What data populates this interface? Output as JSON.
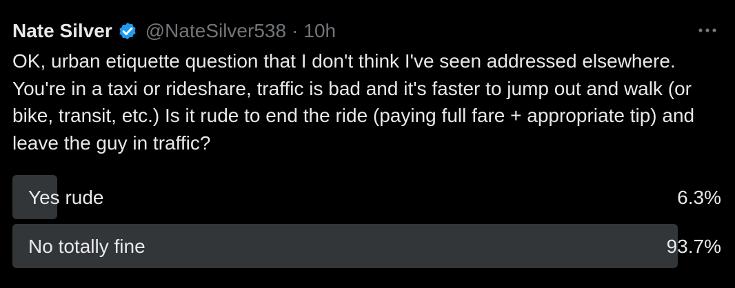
{
  "tweet": {
    "author_name": "Nate Silver",
    "handle": "@NateSilver538",
    "separator": "·",
    "time": "10h",
    "text": "OK, urban etiquette question that I don't think I've seen addressed elsewhere. You're in a taxi or rideshare, traffic is bad and it's faster to jump out and walk (or bike, transit, etc.) Is it rude to end the ride (paying full fare + appropriate tip) and leave the guy in traffic?",
    "verified_icon": "verified-badge-icon",
    "more_icon": "more-options-icon"
  },
  "poll": {
    "options": [
      {
        "label": "Yes rude",
        "percent_text": "6.3%",
        "fraction": 0.063
      },
      {
        "label": "No totally fine",
        "percent_text": "93.7%",
        "fraction": 0.937
      }
    ]
  },
  "colors": {
    "background": "#000000",
    "text": "#e7e9ea",
    "muted": "#71767b",
    "verified_blue": "#1d9bf0",
    "poll_bar": "#333639"
  }
}
